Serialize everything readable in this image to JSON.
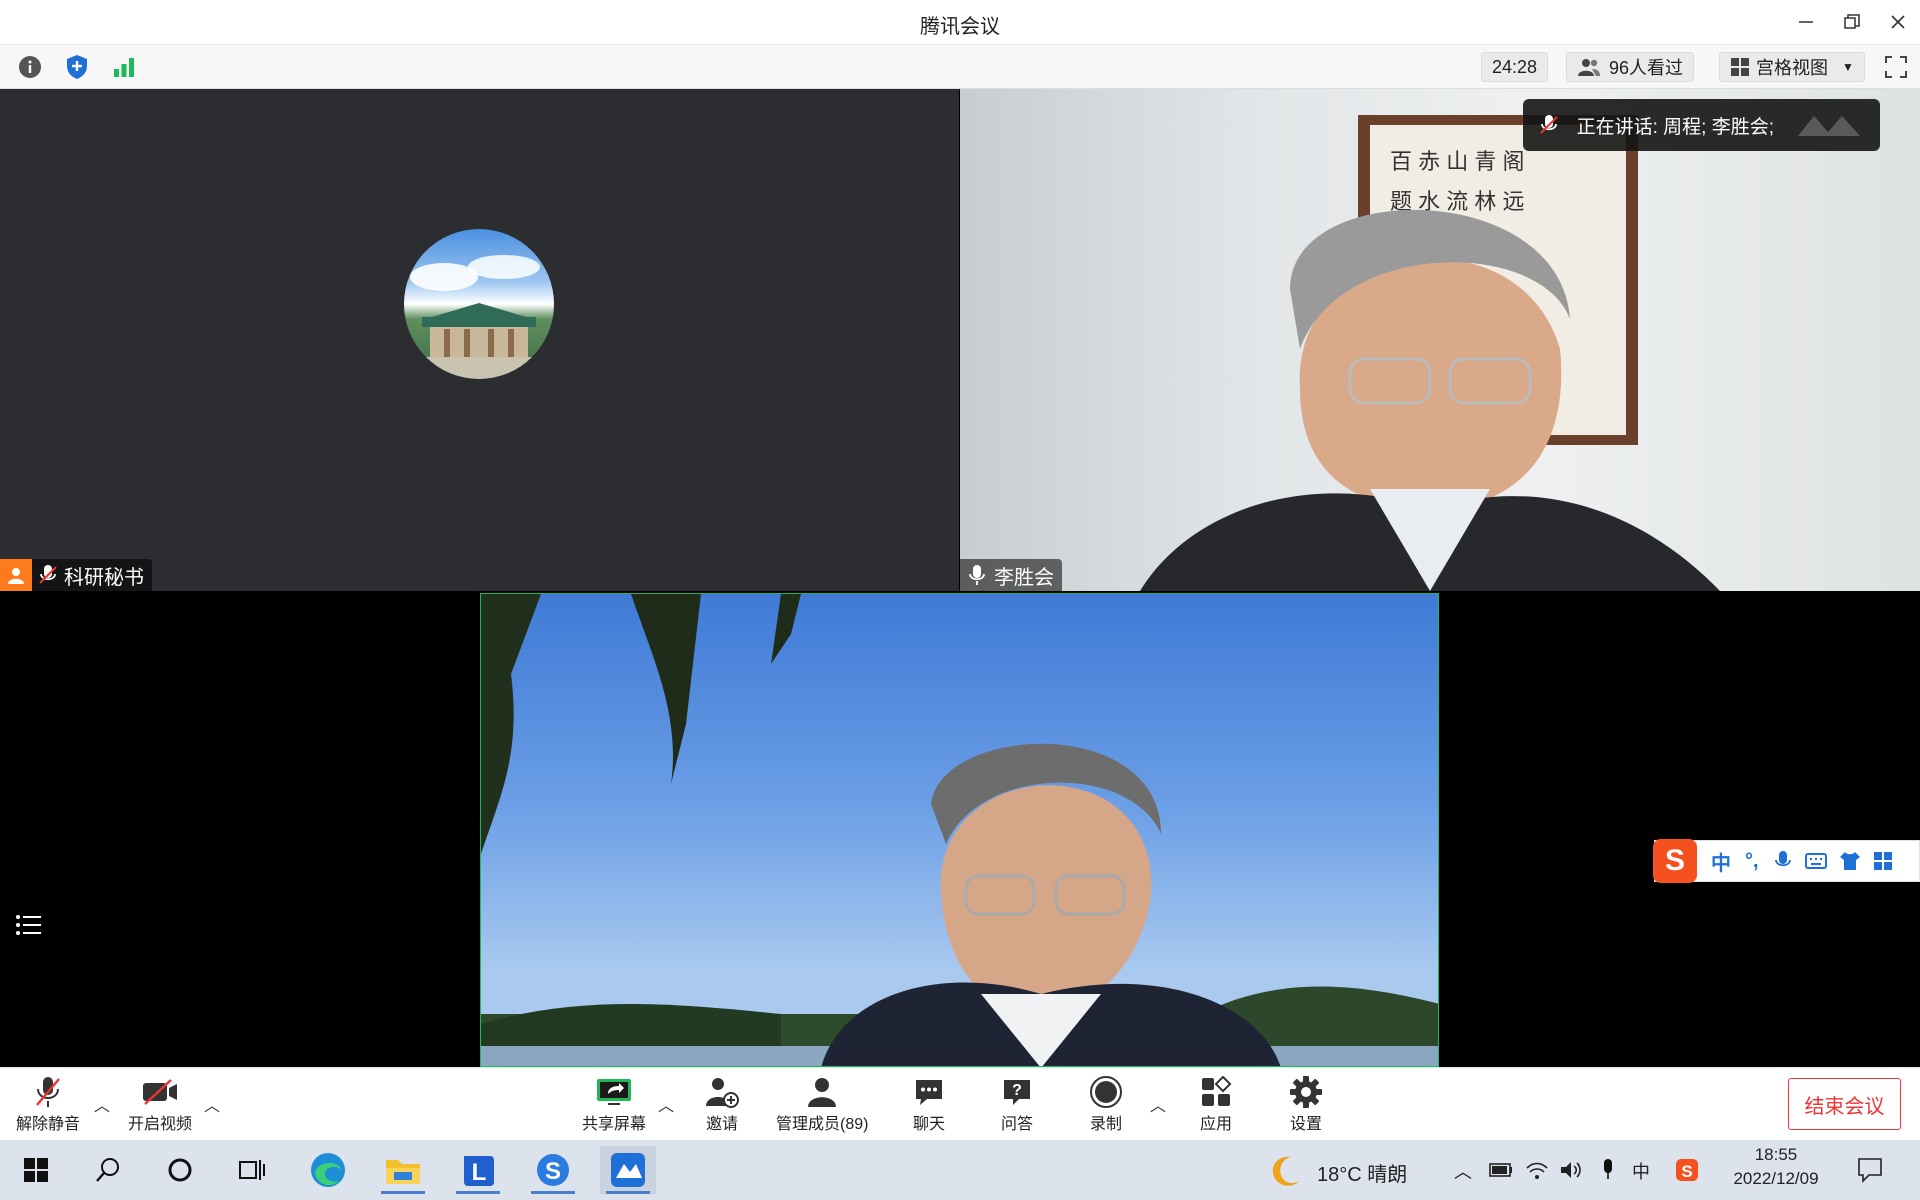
{
  "window": {
    "title": "腾讯会议"
  },
  "topbar": {
    "timer": "24:28",
    "viewers": "96人看过",
    "view_mode": "宫格视图"
  },
  "tiles": {
    "secretary": {
      "name": "科研秘书"
    },
    "li": {
      "name": "李胜会"
    },
    "speaking": "正在讲话: 周程; 李胜会;"
  },
  "ime": {
    "lang": "中",
    "punct": "°,"
  },
  "toolbar": {
    "unmute": "解除静音",
    "start_video": "开启视频",
    "share": "共享屏幕",
    "invite": "邀请",
    "members": "管理成员(89)",
    "chat": "聊天",
    "qa": "问答",
    "record": "录制",
    "apps": "应用",
    "settings": "设置",
    "end": "结束会议"
  },
  "taskbar": {
    "weather": "18°C 晴朗",
    "ime": "中",
    "time": "18:55",
    "date": "2022/12/09"
  },
  "colors": {
    "accent": "#1e6fd6",
    "danger": "#e33333",
    "green": "#1fb85a"
  }
}
